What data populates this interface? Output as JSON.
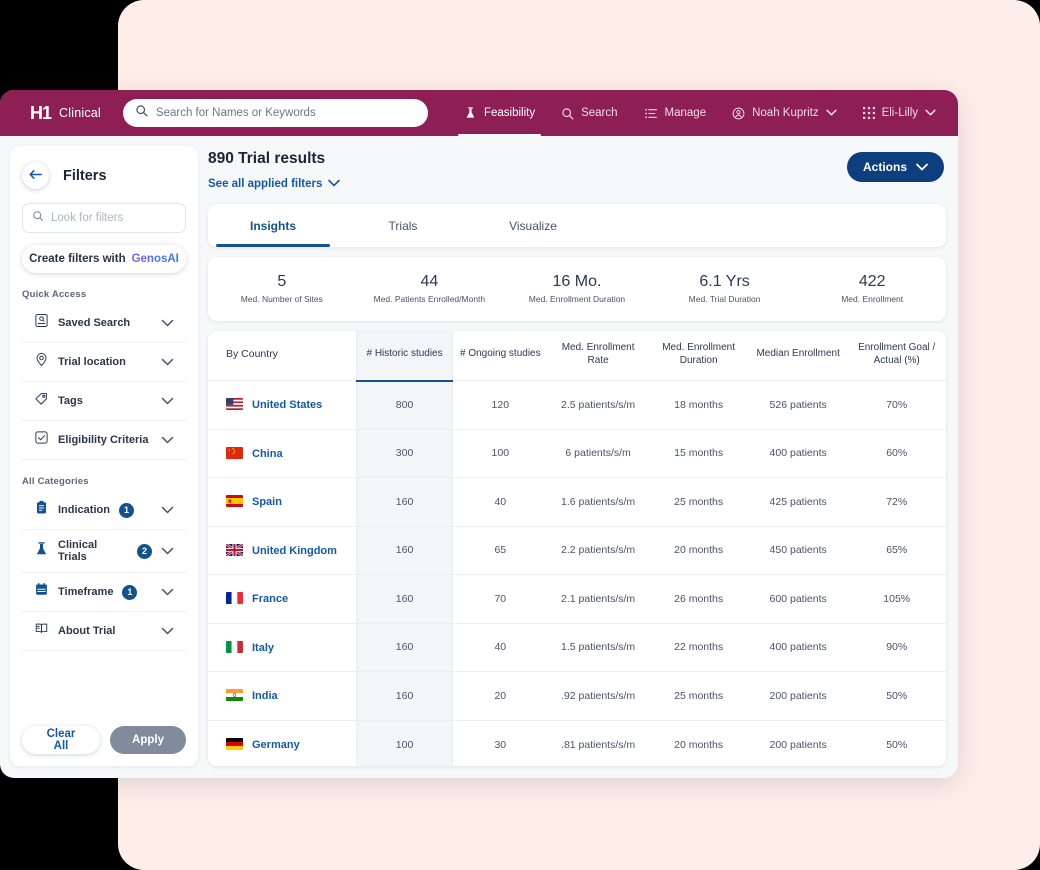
{
  "topnav": {
    "logo_mark": "H1",
    "logo_text": "Clinical",
    "search_placeholder": "Search for Names or Keywords",
    "search_value": "",
    "items": [
      {
        "label": "Feasibility",
        "icon": "flask-icon",
        "active": true
      },
      {
        "label": "Search",
        "icon": "search-icon",
        "active": false
      },
      {
        "label": "Manage",
        "icon": "list-icon",
        "active": false
      }
    ],
    "user": {
      "label": "Noah Kupritz",
      "icon": "user-circle-icon"
    },
    "org": {
      "label": "Eli-Lilly",
      "icon": "grid-icon"
    }
  },
  "sidebar": {
    "title": "Filters",
    "back_icon": "arrow-left-icon",
    "search_placeholder": "Look for filters",
    "search_value": "",
    "genos_button": {
      "prefix": "Create filters with",
      "brand": "GenosAI"
    },
    "quick_access_title": "Quick Access",
    "quick_access": [
      {
        "label": "Saved Search",
        "icon": "saved-search-icon",
        "badge": ""
      },
      {
        "label": "Trial location",
        "icon": "map-pin-icon",
        "badge": ""
      },
      {
        "label": "Tags",
        "icon": "tag-icon",
        "badge": ""
      },
      {
        "label": "Eligibility Criteria",
        "icon": "checkbox-icon",
        "badge": ""
      }
    ],
    "all_categories_title": "All Categories",
    "all_categories": [
      {
        "label": "Indication",
        "icon": "clipboard-icon",
        "badge": "1"
      },
      {
        "label": "Clinical Trials",
        "icon": "flask-icon",
        "badge": "2"
      },
      {
        "label": "Timeframe",
        "icon": "calendar-icon",
        "badge": "1"
      },
      {
        "label": "About Trial",
        "icon": "book-icon",
        "badge": ""
      }
    ],
    "clear_label": "Clear All",
    "apply_label": "Apply"
  },
  "main": {
    "results_title": "890 Trial results",
    "applied_filters_link": "See all applied filters",
    "actions_label": "Actions",
    "tabs": [
      {
        "label": "Insights",
        "active": true
      },
      {
        "label": "Trials",
        "active": false
      },
      {
        "label": "Visualize",
        "active": false
      }
    ],
    "stats": [
      {
        "value": "5",
        "label": "Med. Number of Sites"
      },
      {
        "value": "44",
        "label": "Med. Patients Enrolled/Month"
      },
      {
        "value": "16 Mo.",
        "label": "Med. Enrollment Duration"
      },
      {
        "value": "6.1 Yrs",
        "label": "Med. Trial Duration"
      },
      {
        "value": "422",
        "label": "Med. Enrollment"
      }
    ],
    "table": {
      "columns": [
        "By Country",
        "# Historic studies",
        "# Ongoing studies",
        "Med. Enrollment Rate",
        "Med. Enrollment Duration",
        "Median Enrollment",
        "Enrollment Goal / Actual (%)"
      ],
      "sorted_column_index": 1,
      "rows": [
        {
          "country": "United States",
          "flag": "us",
          "historic": "800",
          "ongoing": "120",
          "rate": "2.5 patients/s/m",
          "duration": "18 months",
          "median": "526 patients",
          "goal": "70%"
        },
        {
          "country": "China",
          "flag": "cn",
          "historic": "300",
          "ongoing": "100",
          "rate": "6 patients/s/m",
          "duration": "15 months",
          "median": "400 patients",
          "goal": "60%"
        },
        {
          "country": "Spain",
          "flag": "es",
          "historic": "160",
          "ongoing": "40",
          "rate": "1.6 patients/s/m",
          "duration": "25 months",
          "median": "425 patients",
          "goal": "72%"
        },
        {
          "country": "United Kingdom",
          "flag": "gb",
          "historic": "160",
          "ongoing": "65",
          "rate": "2.2 patients/s/m",
          "duration": "20 months",
          "median": "450 patients",
          "goal": "65%"
        },
        {
          "country": "France",
          "flag": "fr",
          "historic": "160",
          "ongoing": "70",
          "rate": "2.1 patients/s/m",
          "duration": "26 months",
          "median": "600 patients",
          "goal": "105%"
        },
        {
          "country": "Italy",
          "flag": "it",
          "historic": "160",
          "ongoing": "40",
          "rate": "1.5 patients/s/m",
          "duration": "22 months",
          "median": "400 patients",
          "goal": "90%"
        },
        {
          "country": "India",
          "flag": "in",
          "historic": "160",
          "ongoing": "20",
          "rate": ".92 patients/s/m",
          "duration": "25 months",
          "median": "200 patients",
          "goal": "50%"
        },
        {
          "country": "Germany",
          "flag": "de",
          "historic": "100",
          "ongoing": "30",
          "rate": ".81 patients/s/m",
          "duration": "20 months",
          "median": "200 patients",
          "goal": "50%"
        }
      ]
    }
  },
  "colors": {
    "brand_magenta": "#8e1f55",
    "accent_blue": "#12538f",
    "action_blue": "#0d3f7e",
    "backdrop_pink": "#fdeeea",
    "link_blue": "#1459a8"
  }
}
